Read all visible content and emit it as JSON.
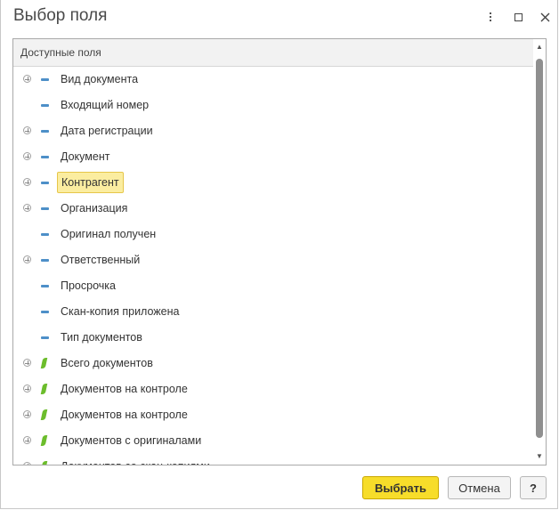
{
  "window": {
    "title": "Выбор поля",
    "more_icon": "more-vertical-icon",
    "maximize_icon": "maximize-icon",
    "close_icon": "close-icon"
  },
  "tree": {
    "header": "Доступные поля",
    "rows": [
      {
        "label": "Вид документа",
        "expandable": true,
        "icon": "field-icon"
      },
      {
        "label": "Входящий номер",
        "expandable": false,
        "icon": "field-icon"
      },
      {
        "label": "Дата регистрации",
        "expandable": true,
        "icon": "field-icon"
      },
      {
        "label": "Документ",
        "expandable": true,
        "icon": "field-icon"
      },
      {
        "label": "Контрагент",
        "expandable": true,
        "icon": "field-icon",
        "selected": true
      },
      {
        "label": "Организация",
        "expandable": true,
        "icon": "field-icon"
      },
      {
        "label": "Оригинал получен",
        "expandable": false,
        "icon": "field-icon"
      },
      {
        "label": "Ответственный",
        "expandable": true,
        "icon": "field-icon"
      },
      {
        "label": "Просрочка",
        "expandable": false,
        "icon": "field-icon"
      },
      {
        "label": "Скан-копия приложена",
        "expandable": false,
        "icon": "field-icon"
      },
      {
        "label": "Тип документов",
        "expandable": false,
        "icon": "field-icon"
      },
      {
        "label": "Всего документов",
        "expandable": true,
        "icon": "resource-icon"
      },
      {
        "label": "Документов на контроле",
        "expandable": true,
        "icon": "resource-icon"
      },
      {
        "label": "Документов на контроле",
        "expandable": true,
        "icon": "resource-icon"
      },
      {
        "label": "Документов с оригиналами",
        "expandable": true,
        "icon": "resource-icon"
      },
      {
        "label": "Документов со скан-копиями",
        "expandable": true,
        "icon": "resource-icon"
      }
    ]
  },
  "buttons": {
    "select": "Выбрать",
    "cancel": "Отмена",
    "help": "?"
  },
  "colors": {
    "selection_bg": "#fbeda0",
    "primary_button": "#f7dd2a",
    "field_icon": "#4d8fc8",
    "resource_icon": "#6cbd2c"
  }
}
